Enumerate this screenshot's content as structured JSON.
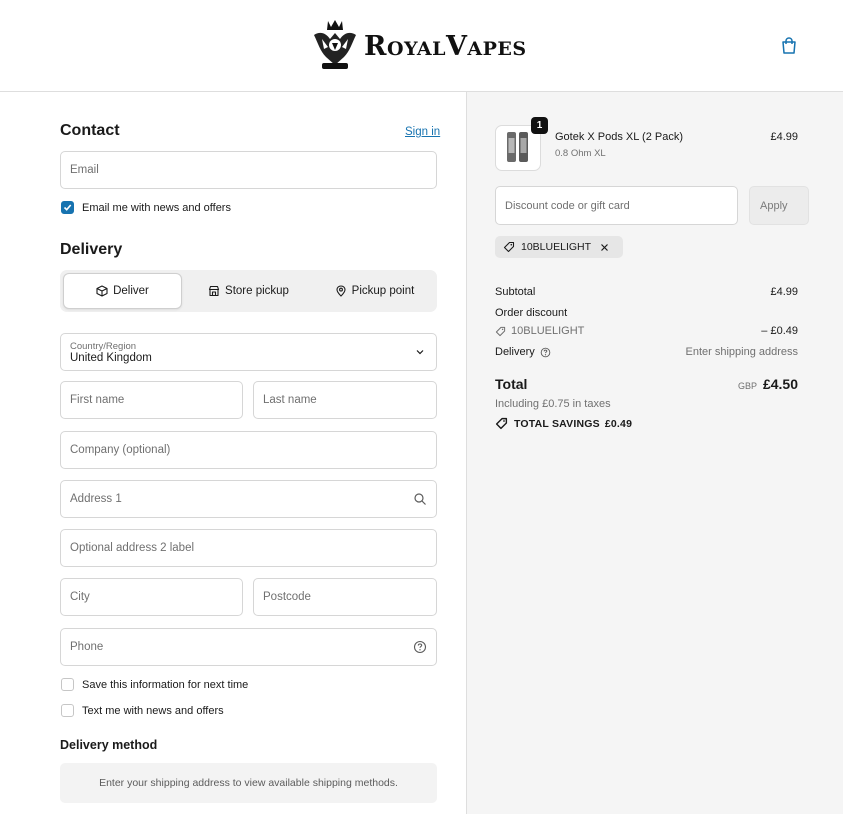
{
  "header": {
    "brand": "RoyalVapes",
    "cart_icon": "shopping-bag-icon"
  },
  "contact": {
    "title": "Contact",
    "sign_in": "Sign in",
    "email_placeholder": "Email",
    "email_news_label": "Email me with news and offers",
    "email_news_checked": true
  },
  "delivery": {
    "title": "Delivery",
    "options": [
      {
        "label": "Deliver",
        "icon": "package-icon",
        "active": true
      },
      {
        "label": "Store pickup",
        "icon": "store-icon",
        "active": false
      },
      {
        "label": "Pickup point",
        "icon": "map-pin-icon",
        "active": false
      }
    ],
    "country_label": "Country/Region",
    "country_value": "United Kingdom",
    "first_name_placeholder": "First name",
    "last_name_placeholder": "Last name",
    "company_placeholder": "Company (optional)",
    "address1_placeholder": "Address 1",
    "address2_placeholder": "Optional address 2 label",
    "city_placeholder": "City",
    "postcode_placeholder": "Postcode",
    "phone_placeholder": "Phone",
    "save_info_label": "Save this information for next time",
    "text_news_label": "Text me with news and offers"
  },
  "delivery_method": {
    "title": "Delivery method",
    "message": "Enter your shipping address to view available shipping methods."
  },
  "summary": {
    "product": {
      "name": "Gotek X Pods XL (2 Pack)",
      "variant": "0.8 Ohm XL",
      "price": "£4.99",
      "quantity": "1"
    },
    "discount_placeholder": "Discount code or gift card",
    "apply_label": "Apply",
    "applied_code": "10BLUELIGHT",
    "subtotal_label": "Subtotal",
    "subtotal_value": "£4.99",
    "order_discount_label": "Order discount",
    "discount_code": "10BLUELIGHT",
    "discount_value": "– £0.49",
    "delivery_label": "Delivery",
    "delivery_value": "Enter shipping address",
    "total_label": "Total",
    "currency": "GBP",
    "total_value": "£4.50",
    "taxes_note": "Including £0.75 in taxes",
    "savings_label": "TOTAL SAVINGS",
    "savings_value": "£0.49"
  },
  "colors": {
    "accent": "#1773b0",
    "sidebar_bg": "#f5f5f5"
  }
}
